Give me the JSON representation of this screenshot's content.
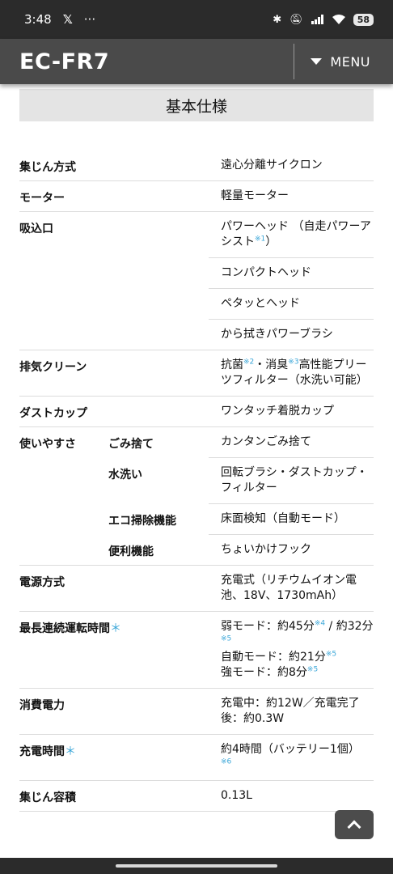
{
  "status_bar": {
    "time": "3:48",
    "left_icons": [
      "x-icon",
      "more-icon"
    ],
    "right_icons": [
      "bluetooth-icon",
      "mute-icon",
      "signal-icon",
      "wifi-icon"
    ],
    "battery": "58"
  },
  "header": {
    "title": "EC-FR7",
    "menu_label": "MENU"
  },
  "section": {
    "title": "基本仕様"
  },
  "specs": {
    "dust_method": {
      "label": "集じん方式",
      "value": "遠心分離サイクロン"
    },
    "motor": {
      "label": "モーター",
      "value": "軽量モーター"
    },
    "nozzle": {
      "label": "吸込口",
      "v1_text": "パワーヘッド （自走パワーアシスト",
      "v1_note": "※1",
      "v1_end": "）",
      "v2": "コンパクトヘッド",
      "v3": "ペタッとヘッド",
      "v4": "から拭きパワーブラシ"
    },
    "exhaust": {
      "label": "排気クリーン",
      "t1": "抗菌",
      "n1": "※2",
      "t2": "・消臭",
      "n2": "※3",
      "t3": "高性能プリーツフィルター（水洗い可能）"
    },
    "dust_cup": {
      "label": "ダストカップ",
      "value": "ワンタッチ着脱カップ"
    },
    "usability": {
      "label": "使いやすさ",
      "items": [
        {
          "sub": "ごみ捨て",
          "value": "カンタンごみ捨て"
        },
        {
          "sub": "水洗い",
          "value": "回転ブラシ・ダストカップ・フィルター"
        },
        {
          "sub": "エコ掃除機能",
          "value": "床面検知（自動モード）"
        },
        {
          "sub": "便利機能",
          "value": "ちょいかけフック"
        }
      ]
    },
    "power_source": {
      "label": "電源方式",
      "value": "充電式（リチウムイオン電池、18V、1730mAh）"
    },
    "runtime": {
      "label": "最長連続運転時間",
      "star": "＊",
      "weak_a": "弱モード：約45分",
      "weak_a_note": "※4",
      "weak_b": " / 約32分",
      "weak_b_note": "※5",
      "auto": "自動モード：約21分",
      "auto_note": "※5",
      "strong": "強モード：約8分",
      "strong_note": "※5"
    },
    "consumption": {
      "label": "消費電力",
      "value": "充電中：約12W／充電完了後：約0.3W"
    },
    "charge_time": {
      "label": "充電時間",
      "star": "＊",
      "value": "約4時間（バッテリー1個）",
      "note": "※6"
    },
    "capacity": {
      "label": "集じん容積",
      "value": "0.13L"
    }
  },
  "colors": {
    "status_bar": "#2b2b2b",
    "app_bar": "#4a4a4a",
    "section_bg": "#e4e4e4",
    "note_accent": "#3aa6d8"
  }
}
